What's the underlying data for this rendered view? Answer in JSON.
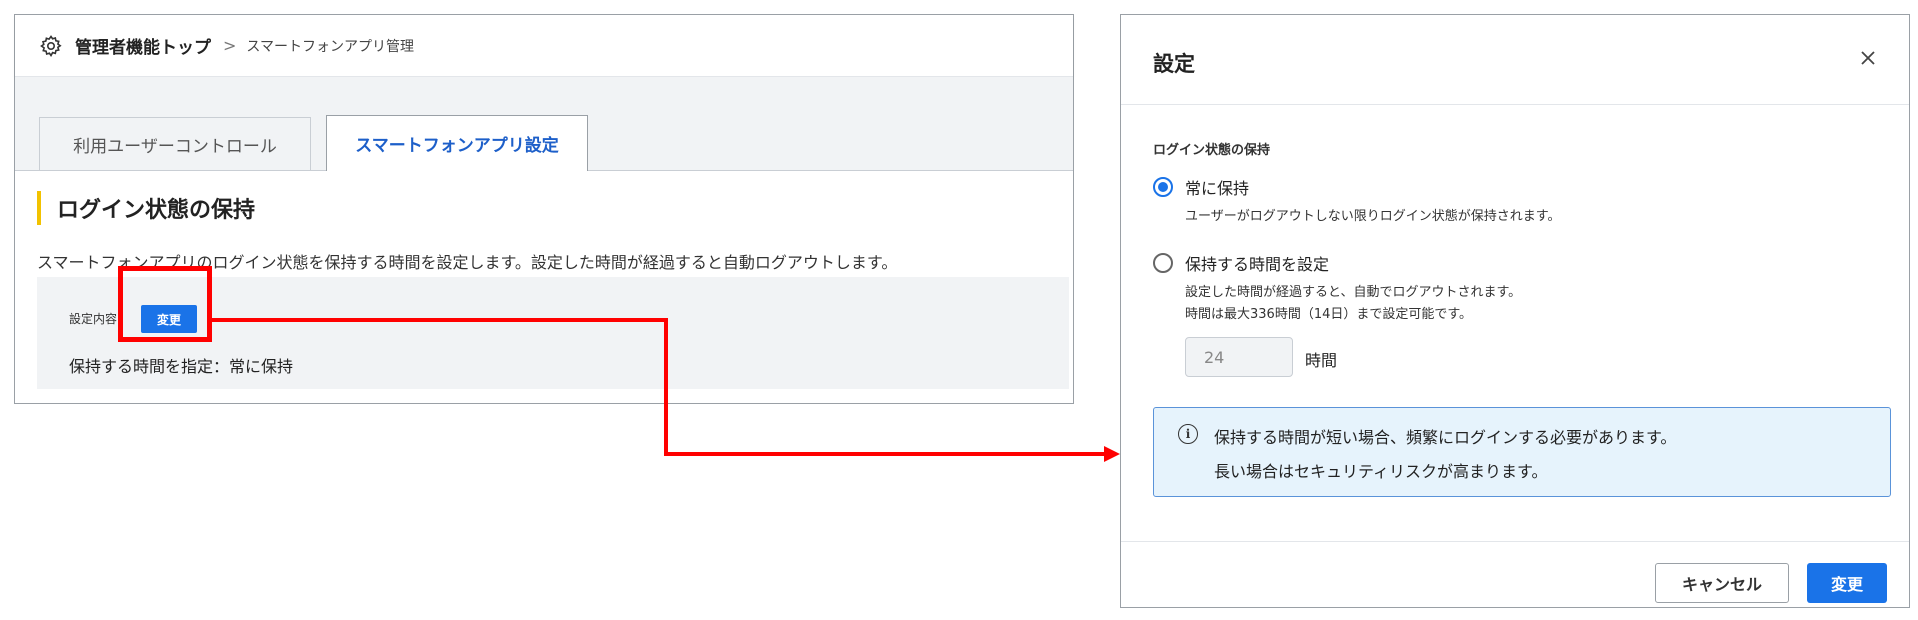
{
  "header": {
    "breadcrumb_root": "管理者機能トップ",
    "breadcrumb_separator": ">",
    "breadcrumb_current": "スマートフォンアプリ管理",
    "icon": "gear-icon"
  },
  "tabs": [
    {
      "label": "利用ユーザーコントロール",
      "active": false
    },
    {
      "label": "スマートフォンアプリ設定",
      "active": true
    }
  ],
  "section": {
    "title": "ログイン状態の保持",
    "description": "スマートフォンアプリのログイン状態を保持する時間を設定します。設定した時間が経過すると自動ログアウトします。",
    "settings_label": "設定内容",
    "change_button": "変更",
    "current_value": "保持する時間を指定：常に保持"
  },
  "modal": {
    "title": "設定",
    "close_icon": "close-icon",
    "field_label": "ログイン状態の保持",
    "options": [
      {
        "label": "常に保持",
        "help": "ユーザーがログアウトしない限りログイン状態が保持されます。",
        "checked": true
      },
      {
        "label": "保持する時間を設定",
        "help_line1": "設定した時間が経過すると、自動でログアウトされます。",
        "help_line2": "時間は最大336時間（14日）まで設定可能です。",
        "checked": false
      }
    ],
    "hours_value": "24",
    "hours_unit": "時間",
    "info_icon": "info-icon",
    "info_line1": "保持する時間が短い場合、頻繁にログインする必要があります。",
    "info_line2": "長い場合はセキュリティリスクが高まります。",
    "cancel_button": "キャンセル",
    "submit_button": "変更"
  },
  "colors": {
    "accent": "#1a73e8",
    "highlight": "#ff0000",
    "title_bar": "#f2c200",
    "info_bg": "#e6f3fc"
  }
}
